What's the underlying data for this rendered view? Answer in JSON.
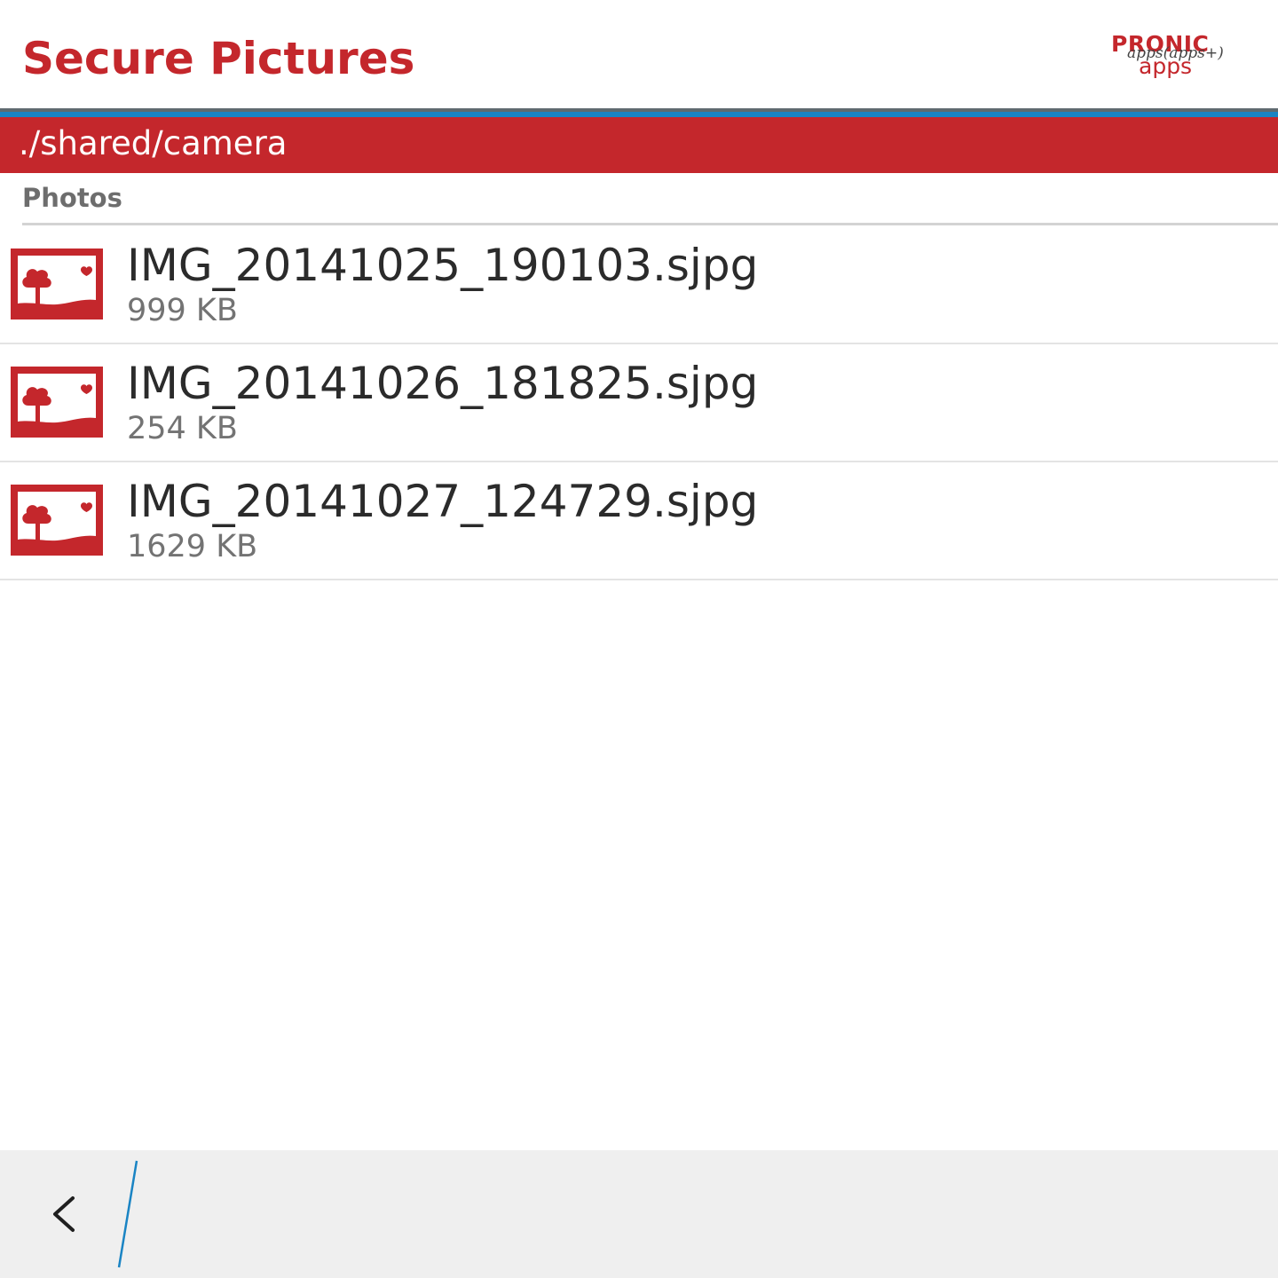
{
  "app": {
    "title": "Secure Pictures",
    "brand": {
      "word": "PRONIC",
      "sub": "apps",
      "scribble": "apps(apps+)",
      "color": "#c4272c"
    },
    "accent_color": "#c4272c",
    "stripe_color": "#1a84c4"
  },
  "path": {
    "text": "./shared/camera"
  },
  "section": {
    "label": "Photos"
  },
  "files": [
    {
      "name": "IMG_20141025_190103.sjpg",
      "size": "999 KB",
      "icon": "picture-icon"
    },
    {
      "name": "IMG_20141026_181825.sjpg",
      "size": "254 KB",
      "icon": "picture-icon"
    },
    {
      "name": "IMG_20141027_124729.sjpg",
      "size": "1629 KB",
      "icon": "picture-icon"
    }
  ],
  "action_bar": {
    "back_icon": "chevron-left-icon"
  }
}
